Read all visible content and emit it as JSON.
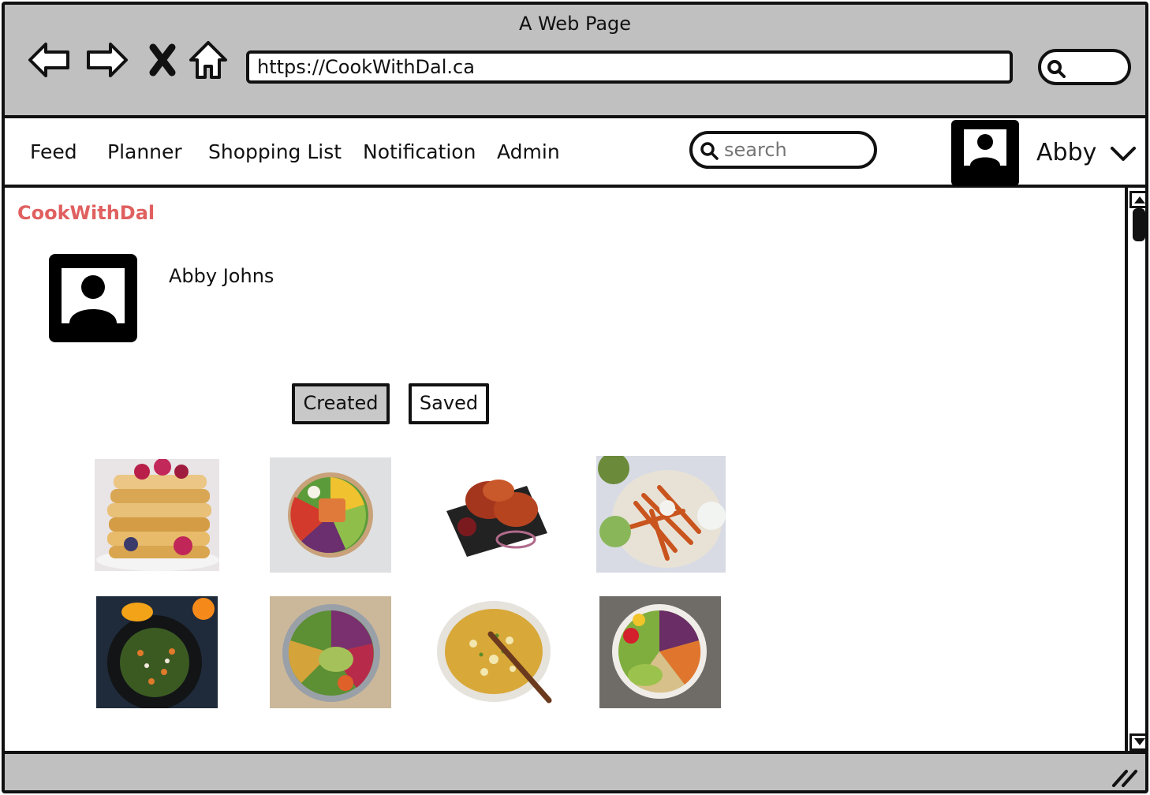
{
  "window": {
    "title": "A Web Page"
  },
  "browser": {
    "url": "https://CookWithDal.ca",
    "icons": [
      "back-arrow-icon",
      "forward-arrow-icon",
      "close-icon",
      "home-icon",
      "search-icon"
    ]
  },
  "nav": {
    "items": [
      {
        "label": "Feed"
      },
      {
        "label": "Planner"
      },
      {
        "label": "Shopping List"
      },
      {
        "label": "Notification"
      },
      {
        "label": "Admin"
      }
    ],
    "search_placeholder": "search",
    "user": "Abby"
  },
  "page": {
    "brand": "CookWithDal",
    "brand_color": "#e06060",
    "profile_name": "Abby Johns",
    "tabs": [
      {
        "label": "Created",
        "selected": true
      },
      {
        "label": "Saved",
        "selected": false
      }
    ],
    "photos": [
      {
        "subject": "pancakes-with-berries"
      },
      {
        "subject": "salmon-salad-bowl"
      },
      {
        "subject": "roast-chicken-plate"
      },
      {
        "subject": "sweet-potato-fries-platter"
      },
      {
        "subject": "green-salad-plate"
      },
      {
        "subject": "veggie-bowl-avocado"
      },
      {
        "subject": "noodle-soup-pot"
      },
      {
        "subject": "chickpea-veggie-bowl"
      }
    ]
  }
}
